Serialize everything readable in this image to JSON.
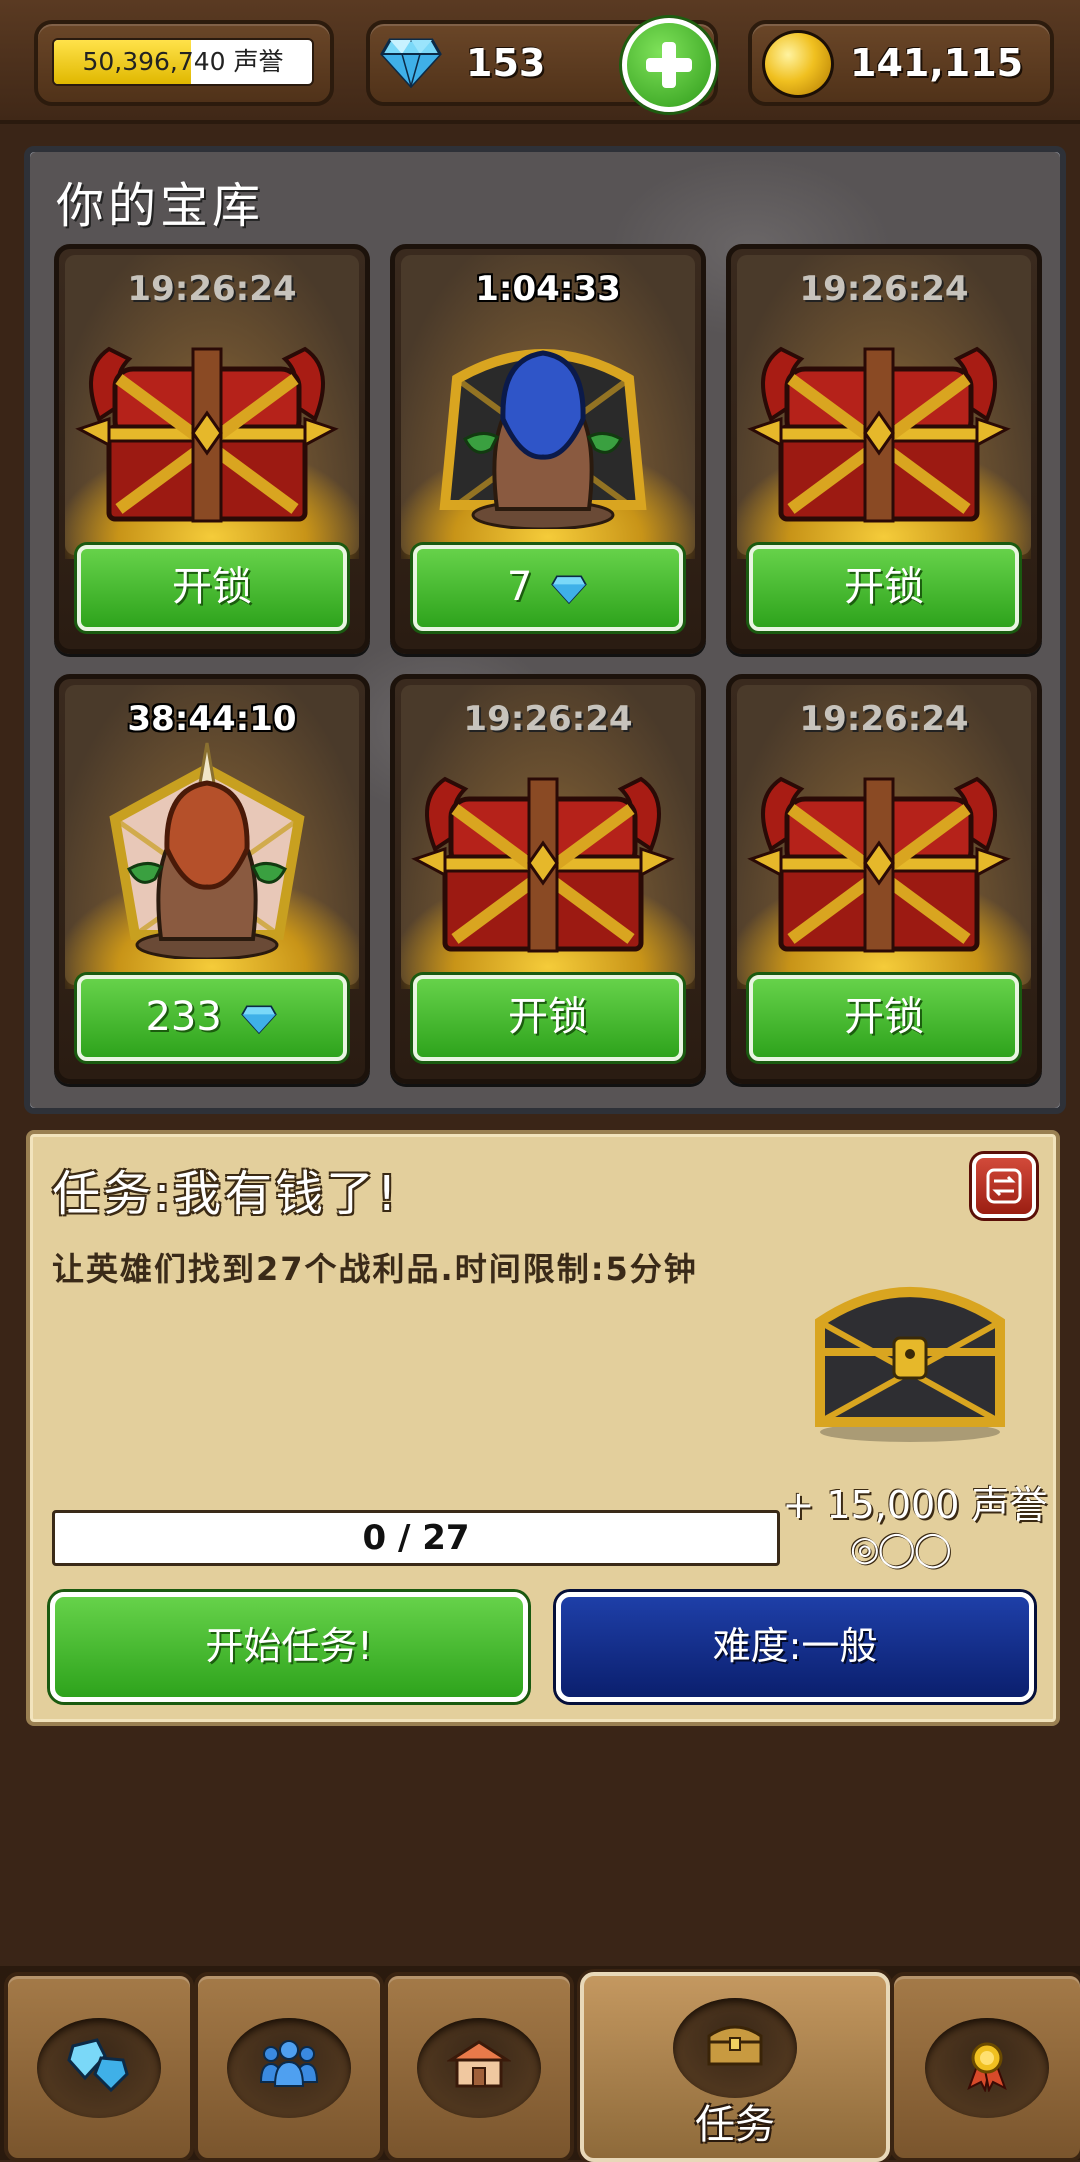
{
  "top_bar": {
    "reputation_value": "50,396,740 声誉",
    "reputation_progress": 0.53,
    "gems": "153",
    "gold": "141,115",
    "gem_icon": "diamond-icon",
    "gold_icon": "gold-coin-icon"
  },
  "vault": {
    "title": "你的宝库",
    "slots": [
      {
        "timer": "19:26:24",
        "chest": "horned-red-chest",
        "button": "开锁",
        "cost_icon": ""
      },
      {
        "timer": "1:04:33",
        "chest": "goblin-blue-hood-chest",
        "button": "7",
        "cost_icon": "diamond-icon"
      },
      {
        "timer": "19:26:24",
        "chest": "horned-red-chest",
        "button": "开锁",
        "cost_icon": ""
      },
      {
        "timer": "38:44:10",
        "chest": "goblin-orange-hood-chest",
        "button": "233",
        "cost_icon": "diamond-icon"
      },
      {
        "timer": "19:26:24",
        "chest": "horned-red-chest",
        "button": "开锁",
        "cost_icon": ""
      },
      {
        "timer": "19:26:24",
        "chest": "horned-red-chest",
        "button": "开锁",
        "cost_icon": ""
      }
    ]
  },
  "quest": {
    "title": "任务:我有钱了!",
    "description": "让英雄们找到27个战利品.时间限制:5分钟",
    "reward": "+ 15,000 声誉",
    "rating_dots": "◎◯◯",
    "progress": "0 / 27",
    "start_button": "开始任务!",
    "difficulty_button": "难度:一般"
  },
  "nav": {
    "items": [
      {
        "icon": "gems-icon",
        "label": ""
      },
      {
        "icon": "heroes-icon",
        "label": ""
      },
      {
        "icon": "buildings-icon",
        "label": ""
      },
      {
        "icon": "treasure-chest-icon",
        "label": "任务"
      },
      {
        "icon": "medal-icon",
        "label": ""
      }
    ]
  },
  "colors": {
    "button_green": "#3cb526",
    "button_blue": "#13309a",
    "panel_parchment": "#e3cf9c",
    "wood_dark": "#3a2517"
  }
}
